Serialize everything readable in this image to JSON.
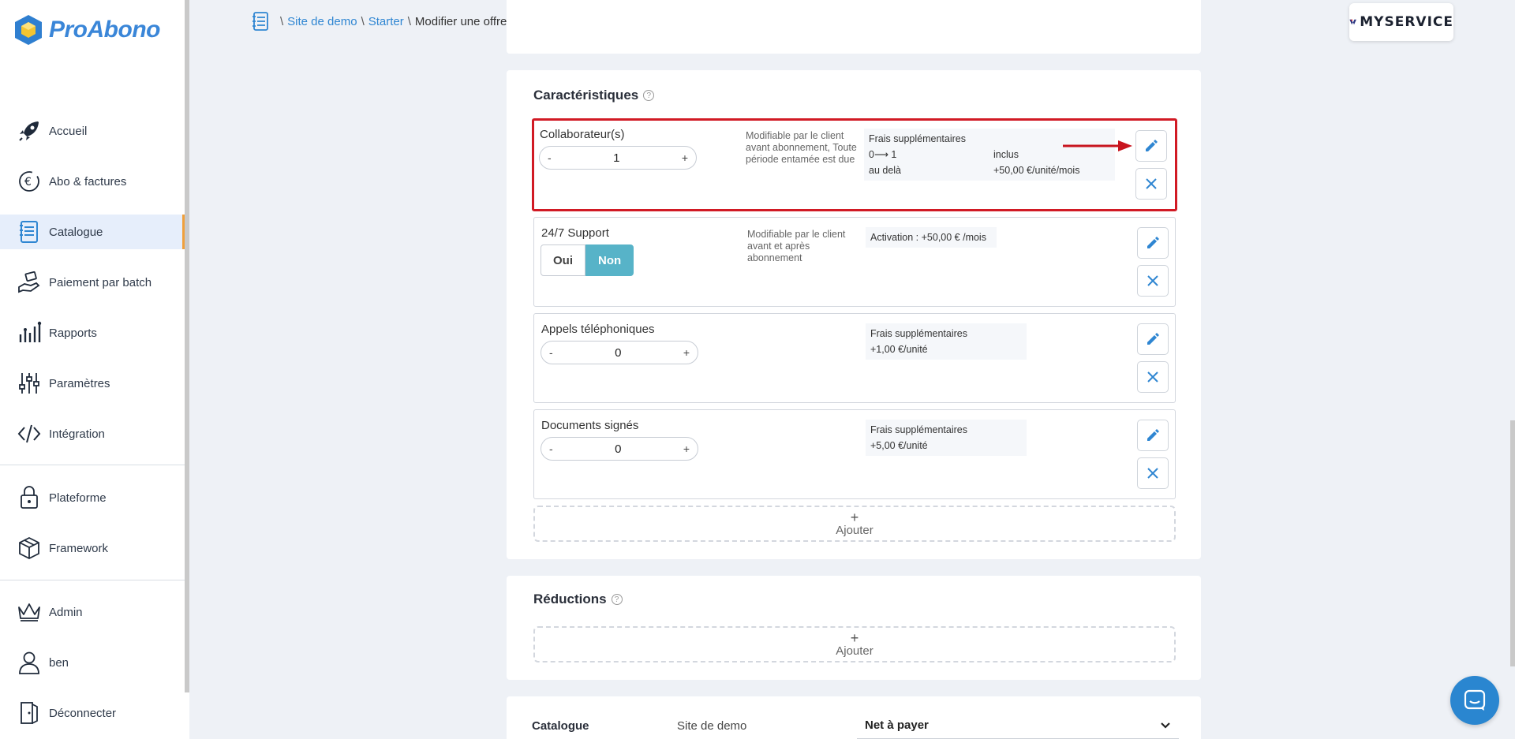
{
  "app": {
    "logo_text": "ProAbono",
    "brand_badge": "MYSERVICE"
  },
  "sidebar": {
    "items": [
      {
        "label": "Accueil",
        "icon": "rocket-icon"
      },
      {
        "label": "Abo & factures",
        "icon": "euro-cycle-icon"
      },
      {
        "label": "Catalogue",
        "icon": "notebook-icon",
        "active": true
      },
      {
        "label": "Paiement par batch",
        "icon": "hand-money-icon"
      },
      {
        "label": "Rapports",
        "icon": "chart-icon"
      },
      {
        "label": "Paramètres",
        "icon": "sliders-icon"
      },
      {
        "label": "Intégration",
        "icon": "code-icon"
      },
      {
        "label": "Plateforme",
        "icon": "lock-icon"
      },
      {
        "label": "Framework",
        "icon": "cube-icon"
      },
      {
        "label": "Admin",
        "icon": "crown-icon"
      },
      {
        "label": "ben",
        "icon": "user-icon"
      },
      {
        "label": "Déconnecter",
        "icon": "door-icon"
      }
    ]
  },
  "breadcrumb": {
    "sep": "\\",
    "site": "Site de demo",
    "offer": "Starter",
    "current": "Modifier une offre"
  },
  "features": {
    "title": "Caractéristiques",
    "help": "?",
    "items": [
      {
        "name": "Collaborateur(s)",
        "value": "1",
        "minus": "-",
        "plus": "+",
        "note": "Modifiable par le client avant abonnement, Toute période entamée est due",
        "pricing_title": "Frais supplémentaires",
        "pricing_rows": [
          [
            "0⟶ 1",
            "inclus"
          ],
          [
            "au delà",
            "+50,00 €/unité/mois"
          ]
        ]
      },
      {
        "name": "24/7 Support",
        "toggle_yes": "Oui",
        "toggle_no": "Non",
        "note": "Modifiable par le client avant et après abonnement",
        "pricing_text": "Activation : +50,00 €  /mois"
      },
      {
        "name": "Appels téléphoniques",
        "value": "0",
        "minus": "-",
        "plus": "+",
        "pricing_title": "Frais supplémentaires",
        "pricing_line": "+1,00 €/unité"
      },
      {
        "name": "Documents signés",
        "value": "0",
        "minus": "-",
        "plus": "+",
        "pricing_title": "Frais supplémentaires",
        "pricing_line": "+5,00 €/unité"
      }
    ],
    "add_plus": "+",
    "add_label": "Ajouter"
  },
  "reductions": {
    "title": "Réductions",
    "help": "?",
    "add_plus": "+",
    "add_label": "Ajouter"
  },
  "summary": {
    "catalogue_label": "Catalogue",
    "catalogue_value": "Site de demo",
    "select_value": "Net à payer"
  },
  "colors": {
    "accent": "#2f86d2",
    "highlight": "#d11a24",
    "toggle_on": "#57b3c8",
    "active_border": "#f0a03c"
  }
}
